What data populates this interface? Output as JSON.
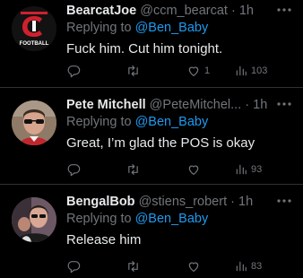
{
  "colors": {
    "background": "#000000",
    "text_primary": "#e7e9ea",
    "text_secondary": "#71767b",
    "mention": "#1d9bf0",
    "divider": "#2f3336"
  },
  "tweets": [
    {
      "display_name": "BearcatJoe",
      "handle": "@ccm_bearcat",
      "separator": "·",
      "time": "1h",
      "replying_prefix": "Replying to ",
      "replying_to": "@Ben_Baby",
      "text": "Fuck him. Cut him tonight.",
      "avatar_text": "FOOTBALL",
      "like_count": "1",
      "view_count": "103",
      "icons": [
        "reply-icon",
        "retweet-icon",
        "like-icon",
        "views-icon",
        "share-icon",
        "more-icon"
      ]
    },
    {
      "display_name": "Pete Mitchell",
      "handle": "@PeteMitchel...",
      "separator": "·",
      "time": "1h",
      "replying_prefix": "Replying to ",
      "replying_to": "@Ben_Baby",
      "text": "Great, I’m glad the POS is okay",
      "view_count": "93",
      "icons": [
        "reply-icon",
        "retweet-icon",
        "like-icon",
        "views-icon",
        "share-icon",
        "more-icon"
      ]
    },
    {
      "display_name": "BengalBob",
      "handle": "@stiens_robert",
      "separator": "·",
      "time": "1h",
      "replying_prefix": "Replying to ",
      "replying_to": "@Ben_Baby",
      "text": "Release him",
      "view_count": "83",
      "icons": [
        "reply-icon",
        "retweet-icon",
        "like-icon",
        "views-icon",
        "share-icon",
        "more-icon"
      ]
    }
  ]
}
